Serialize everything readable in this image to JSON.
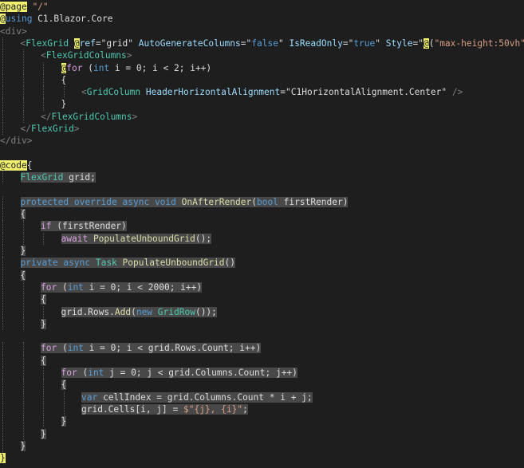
{
  "editor": {
    "language": "Razor (Blazor)",
    "colors": {
      "background": "#1e1e1e",
      "razor_marker": "#f0f070",
      "markup_tag": "#808080",
      "component": "#4ec9b0",
      "attribute": "#9cdcfe",
      "string": "#d69d85",
      "keyword": "#569cd6",
      "method": "#dcdcaa",
      "control_keyword": "#d8a0df"
    },
    "lines": [
      [
        [
          "razor",
          "@page"
        ],
        [
          "pl",
          " "
        ],
        [
          "str",
          "\"/\""
        ]
      ],
      [
        [
          "razor",
          "@"
        ],
        [
          "kw",
          "using"
        ],
        [
          "pl",
          " C1.Blazor.Core"
        ]
      ],
      [
        [
          "tag",
          "<div>"
        ]
      ],
      [
        [
          "tag",
          "<"
        ],
        [
          "comp",
          "FlexGrid"
        ],
        [
          "pl",
          " "
        ],
        [
          "razor",
          "@"
        ],
        [
          "attr",
          "ref"
        ],
        [
          "pl",
          "="
        ],
        [
          "pl",
          "\"grid\""
        ],
        [
          "pl",
          " "
        ],
        [
          "attr",
          "AutoGenerateColumns"
        ],
        [
          "pl",
          "="
        ],
        [
          "pl",
          "\""
        ],
        [
          "kw",
          "false"
        ],
        [
          "pl",
          "\""
        ],
        [
          "pl",
          " "
        ],
        [
          "attr",
          "IsReadOnly"
        ],
        [
          "pl",
          "="
        ],
        [
          "pl",
          "\""
        ],
        [
          "kw",
          "true"
        ],
        [
          "pl",
          "\""
        ],
        [
          "pl",
          " "
        ],
        [
          "attr",
          "Style"
        ],
        [
          "pl",
          "="
        ],
        [
          "pl",
          "\""
        ],
        [
          "razor",
          "@"
        ],
        [
          "pl",
          "("
        ],
        [
          "str",
          "\"max-height:50vh\""
        ],
        [
          "pl",
          ")"
        ],
        [
          "pl",
          "\""
        ],
        [
          "tag",
          ">"
        ]
      ],
      [
        [
          "tag",
          "<"
        ],
        [
          "comp",
          "FlexGridColumns"
        ],
        [
          "tag",
          ">"
        ]
      ],
      [
        [
          "razor",
          "@"
        ],
        [
          "ctl",
          "for"
        ],
        [
          "pl",
          " ("
        ],
        [
          "kw",
          "int"
        ],
        [
          "pl",
          " i = 0; i < 2; i++)"
        ]
      ],
      [
        [
          "pl",
          "{"
        ]
      ],
      [
        [
          "tag",
          "<"
        ],
        [
          "comp",
          "GridColumn"
        ],
        [
          "pl",
          " "
        ],
        [
          "attr",
          "HeaderHorizontalAlignment"
        ],
        [
          "pl",
          "="
        ],
        [
          "pl",
          "\""
        ],
        [
          "pl",
          "C1HorizontalAlignment.Center"
        ],
        [
          "pl",
          "\""
        ],
        [
          "pl",
          " "
        ],
        [
          "tag",
          "/>"
        ]
      ],
      [
        [
          "pl",
          "}"
        ]
      ],
      [
        [
          "tag",
          "</"
        ],
        [
          "comp",
          "FlexGridColumns"
        ],
        [
          "tag",
          ">"
        ]
      ],
      [
        [
          "tag",
          "</"
        ],
        [
          "comp",
          "FlexGrid"
        ],
        [
          "tag",
          ">"
        ]
      ],
      [
        [
          "tag",
          "</div>"
        ]
      ],
      [],
      [
        [
          "razor",
          "@code"
        ],
        [
          "pl",
          "{"
        ]
      ],
      [
        [
          "type",
          "FlexGrid"
        ],
        [
          "pl",
          " grid;"
        ]
      ],
      [],
      [
        [
          "kw",
          "protected"
        ],
        [
          "pl",
          " "
        ],
        [
          "kw",
          "override"
        ],
        [
          "pl",
          " "
        ],
        [
          "kw",
          "async"
        ],
        [
          "pl",
          " "
        ],
        [
          "kw",
          "void"
        ],
        [
          "pl",
          " "
        ],
        [
          "meth",
          "OnAfterRender"
        ],
        [
          "pl",
          "("
        ],
        [
          "kw",
          "bool"
        ],
        [
          "pl",
          " firstRender)"
        ]
      ],
      [
        [
          "pl",
          "{"
        ]
      ],
      [
        [
          "ctl",
          "if"
        ],
        [
          "pl",
          " (firstRender)"
        ]
      ],
      [
        [
          "ctl",
          "await"
        ],
        [
          "pl",
          " "
        ],
        [
          "meth",
          "PopulateUnboundGrid"
        ],
        [
          "pl",
          "();"
        ]
      ],
      [
        [
          "pl",
          "}"
        ]
      ],
      [
        [
          "kw",
          "private"
        ],
        [
          "pl",
          " "
        ],
        [
          "kw",
          "async"
        ],
        [
          "pl",
          " "
        ],
        [
          "type",
          "Task"
        ],
        [
          "pl",
          " "
        ],
        [
          "meth",
          "PopulateUnboundGrid"
        ],
        [
          "pl",
          "()"
        ]
      ],
      [
        [
          "pl",
          "{"
        ]
      ],
      [
        [
          "ctl",
          "for"
        ],
        [
          "pl",
          " ("
        ],
        [
          "kw",
          "int"
        ],
        [
          "pl",
          " i = 0; i < 2000; i++)"
        ]
      ],
      [
        [
          "pl",
          "{"
        ]
      ],
      [
        [
          "pl",
          "grid.Rows."
        ],
        [
          "meth",
          "Add"
        ],
        [
          "pl",
          "("
        ],
        [
          "kw",
          "new"
        ],
        [
          "pl",
          " "
        ],
        [
          "type",
          "GridRow"
        ],
        [
          "pl",
          "());"
        ]
      ],
      [
        [
          "pl",
          "}"
        ]
      ],
      [],
      [
        [
          "ctl",
          "for"
        ],
        [
          "pl",
          " ("
        ],
        [
          "kw",
          "int"
        ],
        [
          "pl",
          " i = 0; i < grid.Rows.Count; i++)"
        ]
      ],
      [
        [
          "pl",
          "{"
        ]
      ],
      [
        [
          "ctl",
          "for"
        ],
        [
          "pl",
          " ("
        ],
        [
          "kw",
          "int"
        ],
        [
          "pl",
          " j = 0; j < grid.Columns.Count; j++)"
        ]
      ],
      [
        [
          "pl",
          "{"
        ]
      ],
      [
        [
          "kw",
          "var"
        ],
        [
          "pl",
          " cellIndex = grid.Columns.Count * i + j;"
        ]
      ],
      [
        [
          "pl",
          "grid.Cells[i, j] = "
        ],
        [
          "str",
          "$\"{j}, {i}\""
        ],
        [
          "pl",
          ";"
        ]
      ],
      [
        [
          "pl",
          "}"
        ]
      ],
      [
        [
          "pl",
          "}"
        ]
      ],
      [
        [
          "pl",
          "}"
        ]
      ],
      [
        [
          "razor",
          "}"
        ]
      ]
    ]
  }
}
